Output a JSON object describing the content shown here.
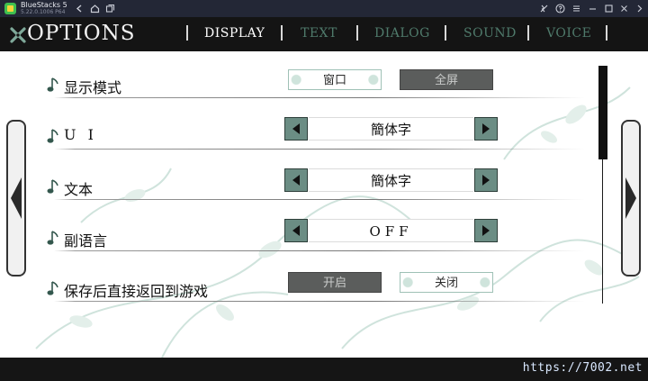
{
  "titlebar": {
    "app_name": "BlueStacks 5",
    "version": "5.22.0.1006 P64",
    "icons": [
      "back-icon",
      "home-icon",
      "multi-instance-icon",
      "eco-mode-icon",
      "help-icon",
      "menu-icon",
      "minimize-icon",
      "restore-icon",
      "close-icon",
      "expand-icon"
    ]
  },
  "header": {
    "logo": "OPTIONS",
    "tabs": [
      {
        "label": "DISPLAY",
        "active": true
      },
      {
        "label": "TEXT",
        "active": false
      },
      {
        "label": "DIALOG",
        "active": false
      },
      {
        "label": "SOUND",
        "active": false
      },
      {
        "label": "VOICE",
        "active": false
      }
    ]
  },
  "settings": {
    "display_mode": {
      "label": "显示模式",
      "option_a": "窗口",
      "option_b": "全屏",
      "selected": "窗口"
    },
    "ui": {
      "label": "U I",
      "value": "簡体字"
    },
    "text": {
      "label": "文本",
      "value": "簡体字"
    },
    "sub_language": {
      "label": "副语言",
      "value": "OFF"
    },
    "return_after_save": {
      "label": "保存后直接返回到游戏",
      "option_a": "开启",
      "option_b": "关闭",
      "selected": "关闭"
    }
  },
  "footer": {
    "watermark": "https://7002.net"
  },
  "colors": {
    "accent": "#6b8d84",
    "tab_inactive": "#4f7a6b",
    "header_bg": "#141414",
    "disabled_button": "#5b5d5c"
  }
}
